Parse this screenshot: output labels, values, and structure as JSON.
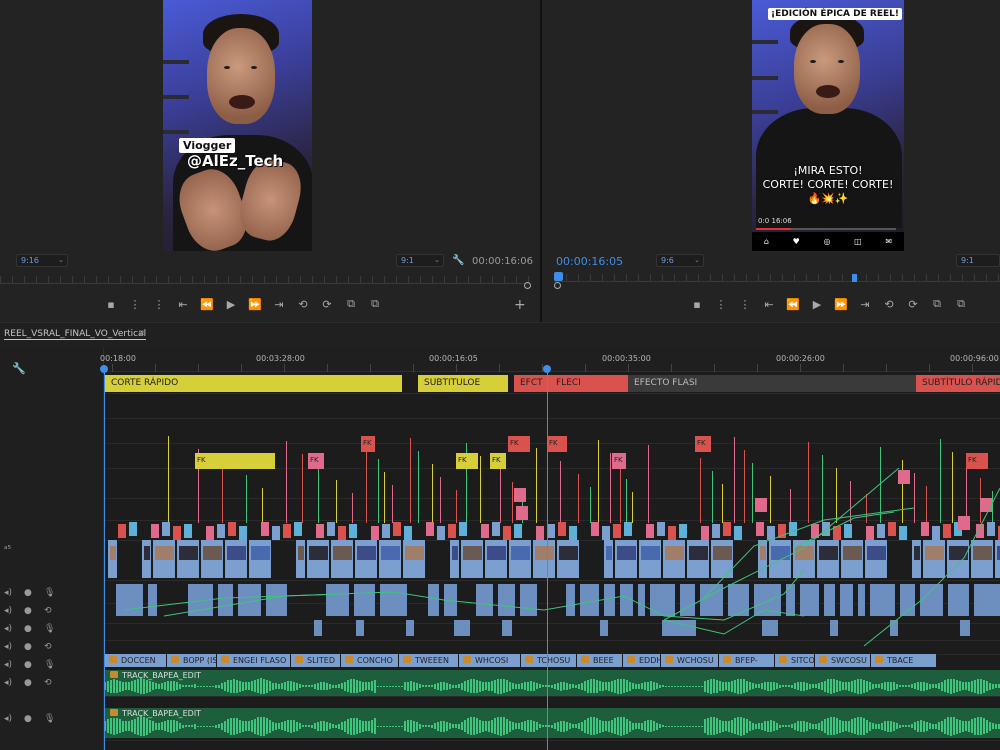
{
  "colors": {
    "accent_blue": "#3d8ee6",
    "marker_yellow": "#d6cf3a",
    "marker_red": "#d9524e",
    "marker_dark": "#3a3a3a",
    "audio_green": "#3fc47b",
    "audio_bg": "#1d5e3c",
    "video_clip": "#7ba0d0",
    "fx_pink": "#e06a8c"
  },
  "source_monitor": {
    "overlay_name": "Viogger",
    "overlay_handle": "@AlEz_Tech",
    "fit_dropdown": "9:16",
    "quality_dropdown": "9:1",
    "timecode": "00:00:16:06",
    "wrench_icon": "wrench-icon"
  },
  "program_monitor": {
    "title_overlay": "¡EDICIÓN ÉPICA DE REEL!",
    "caption_line1": "¡MIRA ESTO!",
    "caption_line2": "CORTE! CORTE! CORTE!",
    "caption_emojis": "🔥💥✨",
    "video_time": "0:0 16:06",
    "phone_icons": [
      "⌂",
      "♥",
      "◎",
      "◫",
      "✉"
    ],
    "timecode": "00:00:16:05",
    "fit_dropdown": "9:6",
    "quality_dropdown": "9:1"
  },
  "transport_source": [
    "▪",
    "⋮",
    "⋮",
    "⇤",
    "⏪",
    "▶",
    "⏩",
    "⇥",
    "⟲",
    "⟳",
    "⧉",
    "⧉"
  ],
  "transport_program": [
    "▪",
    "⋮",
    "⋮",
    "⇤",
    "⏪",
    "▶",
    "⏩",
    "⇥",
    "⟲",
    "⟳",
    "⧉",
    "⧉"
  ],
  "sequence": {
    "name": "REEL_VSRAL_FINAL_VO_Vertical",
    "menu_icon": "≡"
  },
  "ruler": [
    "00:18:00",
    "00:03:28:00",
    "00:00:16:05",
    "00:00:35:00",
    "00:00:26:00",
    "00:00:96:00"
  ],
  "markers": [
    {
      "label": "CORTE RÁPIDO",
      "color": "#d6cf3a"
    },
    {
      "label": "SUBTITULOE",
      "color": "#d6cf3a"
    },
    {
      "label": "EFCT",
      "color": "#d9524e"
    },
    {
      "label": "FLECI",
      "color": "#d9524e"
    },
    {
      "label": "EFECTO FLASI",
      "color": "#3a3a3a"
    },
    {
      "label": "SUBTÍTULO RÁPIDO",
      "color": "#d9524e"
    }
  ],
  "fx_labels": [
    "FK",
    "FK",
    "FK",
    "FK",
    "FK",
    "FK",
    "FK",
    "FK",
    "FK",
    "FK"
  ],
  "audio_clip_labels": [
    "DOCCEN",
    "BOPP (IS",
    "ENGEI FLASO",
    "SLITED",
    "CONCHO",
    "TWEEEN",
    "WHCOSI",
    "TCHOSU",
    "BEEE",
    "EDDHO",
    "WCHOSU",
    "BFEP-",
    "SITCO",
    "SWCOSU",
    "TBACE"
  ],
  "audio_tracks": [
    {
      "name": "TRACK_BAPEA_EDIT"
    },
    {
      "name": "TRACK_BAPEA_EDIT"
    }
  ],
  "track_controls": {
    "wrench": "🔧",
    "video_label": "ᵃ⁵",
    "mute": "◂)",
    "solo": "●",
    "mic": "🎙",
    "sync": "⟲"
  }
}
